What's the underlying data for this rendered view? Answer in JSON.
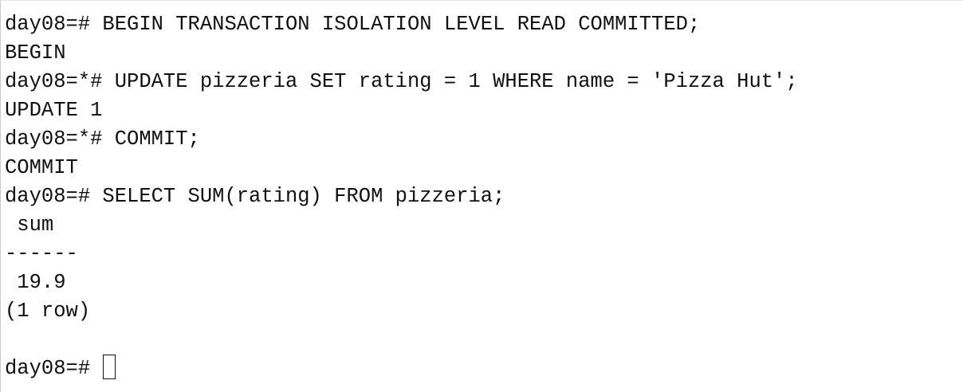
{
  "terminal": {
    "lines": [
      "day08=# BEGIN TRANSACTION ISOLATION LEVEL READ COMMITTED;",
      "BEGIN",
      "day08=*# UPDATE pizzeria SET rating = 1 WHERE name = 'Pizza Hut';",
      "UPDATE 1",
      "day08=*# COMMIT;",
      "COMMIT",
      "day08=# SELECT SUM(rating) FROM pizzeria;",
      " sum",
      "------",
      " 19.9",
      "(1 row)",
      ""
    ],
    "prompt": "day08=# ",
    "input": ""
  }
}
